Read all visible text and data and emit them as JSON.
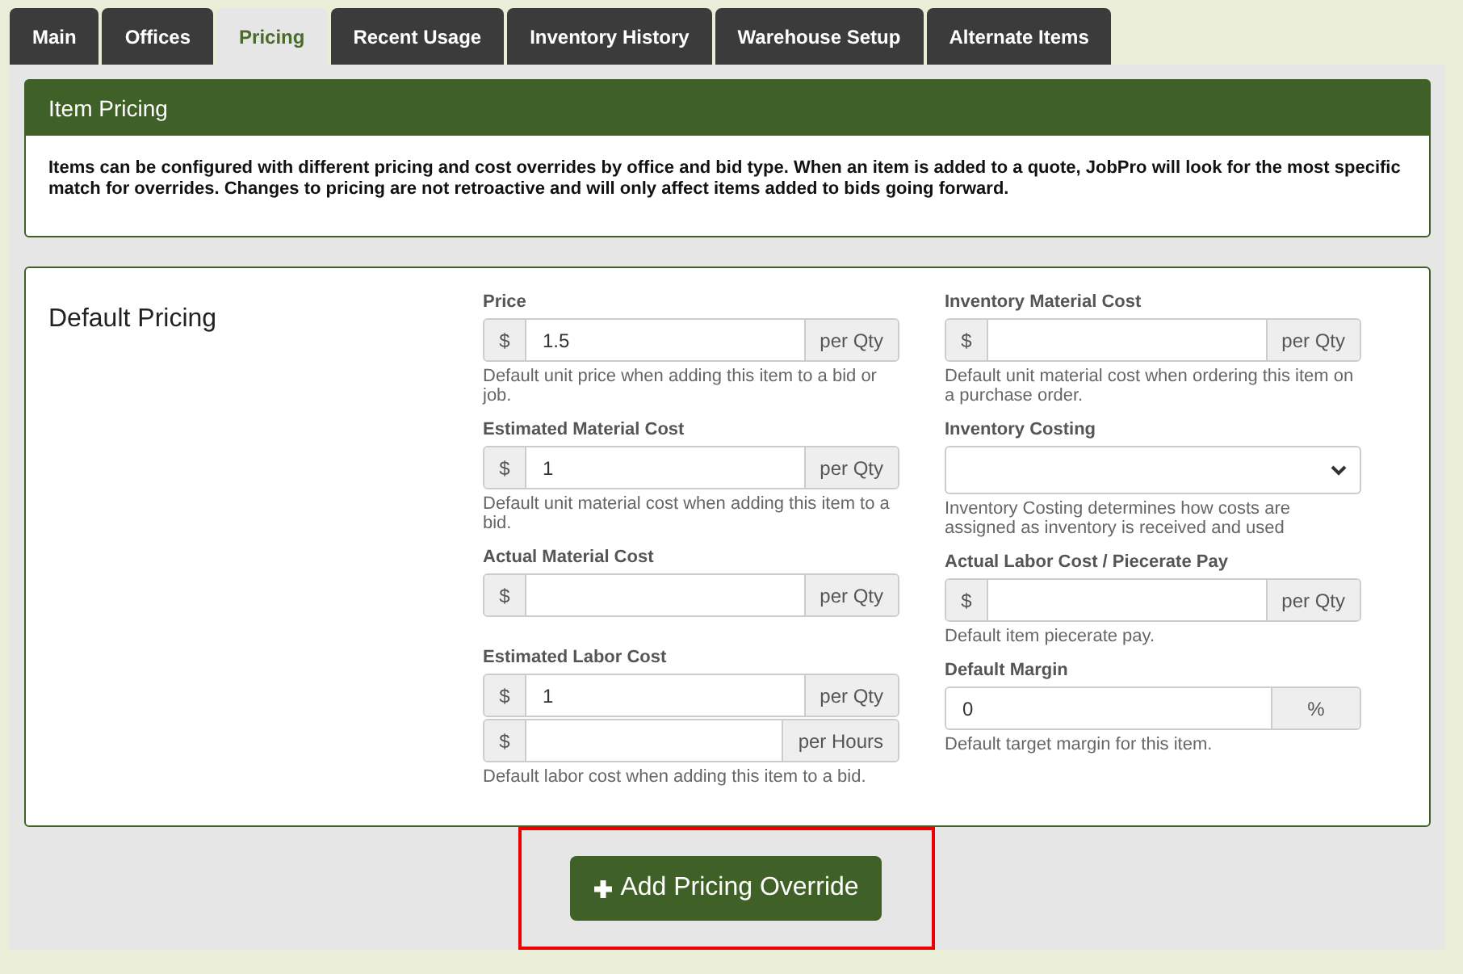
{
  "tabs": [
    {
      "label": "Main",
      "selected": false
    },
    {
      "label": "Offices",
      "selected": false
    },
    {
      "label": "Pricing",
      "selected": true
    },
    {
      "label": "Recent Usage",
      "selected": false
    },
    {
      "label": "Inventory History",
      "selected": false
    },
    {
      "label": "Warehouse Setup",
      "selected": false
    },
    {
      "label": "Alternate Items",
      "selected": false
    }
  ],
  "info_panel": {
    "title": "Item Pricing",
    "text": "Items can be configured with different pricing and cost overrides by office and bid type. When an item is added to a quote, JobPro will look for the most specific match for overrides. Changes to pricing are not retroactive and will only affect items added to bids going forward."
  },
  "pricing_panel": {
    "title": "Default Pricing",
    "columns": [
      [
        {
          "label": "Price",
          "kind": "inputs",
          "inputs": [
            {
              "prefix": "$",
              "value": "1.5",
              "suffix": "per Qty"
            }
          ],
          "help": "Default unit price when adding this item to a bid or job."
        },
        {
          "label": "Estimated Material Cost",
          "kind": "inputs",
          "inputs": [
            {
              "prefix": "$",
              "value": "1",
              "suffix": "per Qty"
            }
          ],
          "help": "Default unit material cost when adding this item to a bid."
        },
        {
          "label": "Actual Material Cost",
          "kind": "inputs",
          "inputs": [
            {
              "prefix": "$",
              "suffix": "per Qty"
            }
          ]
        },
        {
          "label": "Estimated Labor Cost",
          "kind": "inputs",
          "inputs": [
            {
              "prefix": "$",
              "value": "1",
              "suffix": "per Qty"
            },
            {
              "prefix": "$",
              "suffix": "per Hours"
            }
          ],
          "help": "Default labor cost when adding this item to a bid."
        }
      ],
      [
        {
          "label": "Inventory Material Cost",
          "kind": "inputs",
          "inputs": [
            {
              "prefix": "$",
              "suffix": "per Qty"
            }
          ],
          "help": "Default unit material cost when ordering this item on a purchase order."
        },
        {
          "label": "Inventory Costing",
          "kind": "select",
          "help": "Inventory Costing determines how costs are assigned as inventory is received and used"
        },
        {
          "label": "Actual Labor Cost / Piecerate Pay",
          "kind": "inputs",
          "inputs": [
            {
              "prefix": "$",
              "suffix": "per Qty"
            }
          ],
          "help": "Default item piecerate pay."
        },
        {
          "label": "Default Margin",
          "kind": "inputs",
          "inputs": [
            {
              "value": "0",
              "suffix": "%"
            }
          ],
          "help": "Default target margin for this item."
        }
      ]
    ]
  },
  "add_button": {
    "label": "Add Pricing Override",
    "highlighted": true
  }
}
